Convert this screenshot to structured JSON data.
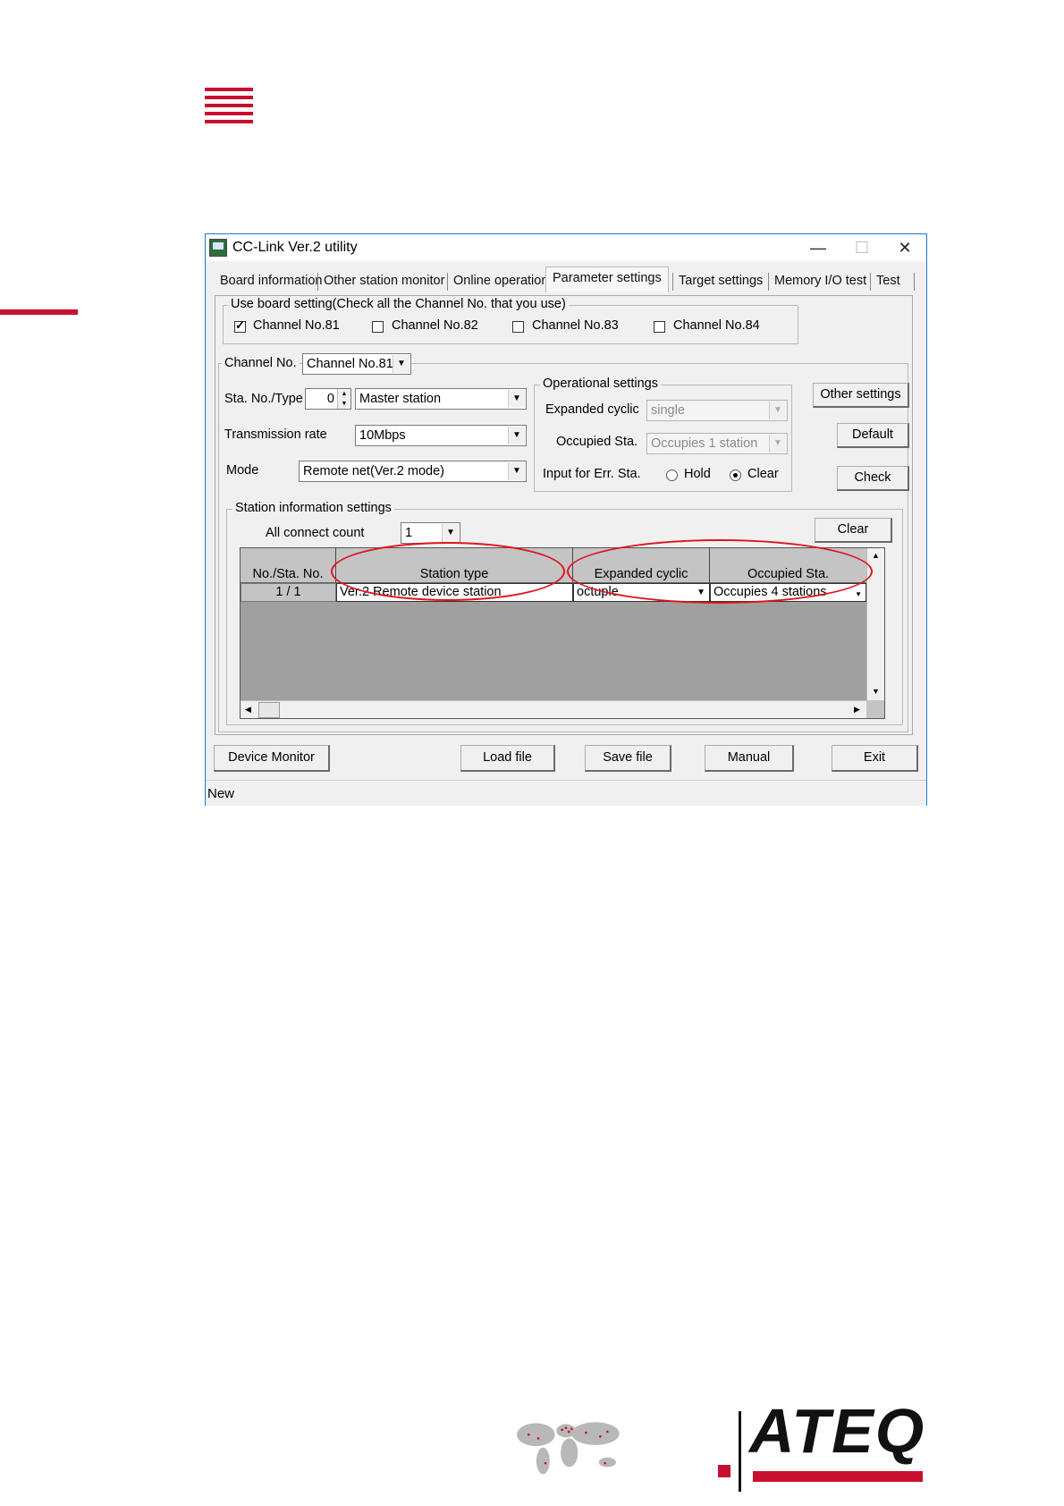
{
  "window": {
    "title": "CC-Link Ver.2 utility",
    "minimize": "—",
    "maximize": "☐",
    "close": "✕"
  },
  "tabs": [
    {
      "label": "Board information"
    },
    {
      "label": "Other station monitor"
    },
    {
      "label": "Online operation"
    },
    {
      "label": "Parameter settings"
    },
    {
      "label": "Target settings"
    },
    {
      "label": "Memory I/O test"
    },
    {
      "label": "Test"
    }
  ],
  "use_board": {
    "legend": "Use board setting(Check all the Channel No. that you use)",
    "channels": [
      {
        "label": "Channel No.81",
        "checked": true
      },
      {
        "label": "Channel No.82",
        "checked": false
      },
      {
        "label": "Channel No.83",
        "checked": false
      },
      {
        "label": "Channel No.84",
        "checked": false
      }
    ]
  },
  "channel": {
    "label": "Channel No.",
    "value": "Channel No.81"
  },
  "station": {
    "sta_label": "Sta. No./Type",
    "sta_no": "0",
    "sta_type": "Master station",
    "rate_label": "Transmission rate",
    "rate": "10Mbps",
    "mode_label": "Mode",
    "mode": "Remote net(Ver.2 mode)"
  },
  "operational": {
    "legend": "Operational settings",
    "expanded_label": "Expanded cyclic",
    "expanded_value": "single",
    "occupied_label": "Occupied Sta.",
    "occupied_value": "Occupies 1 station",
    "input_label": "Input for Err. Sta.",
    "hold": "Hold",
    "clear": "Clear"
  },
  "side_buttons": {
    "other": "Other settings",
    "default": "Default",
    "check": "Check"
  },
  "station_info": {
    "legend": "Station information settings",
    "count_label": "All connect count",
    "count": "1",
    "clear_button": "Clear",
    "headers": [
      "No./Sta. No.",
      "Station type",
      "Expanded cyclic",
      "Occupied Sta."
    ],
    "row": {
      "no": "1 / 1",
      "station_type": "Ver.2 Remote device station",
      "expanded": "octuple",
      "occupied": "Occupies 4 stations"
    }
  },
  "bottom_buttons": {
    "device_monitor": "Device Monitor",
    "load": "Load file",
    "save": "Save file",
    "manual": "Manual",
    "exit": "Exit"
  },
  "status": "New",
  "brand": {
    "name": "ATEQ",
    "accent": "#c8102e"
  }
}
